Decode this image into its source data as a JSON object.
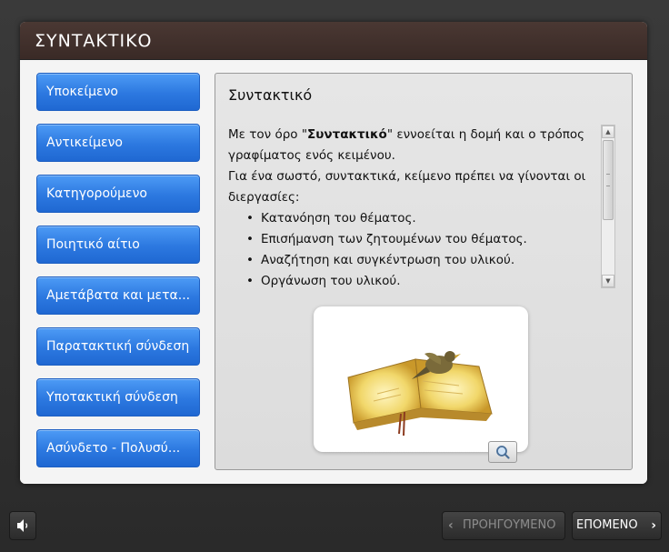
{
  "window": {
    "title": "ΣΥΝΤΑΚΤΙΚΟ"
  },
  "menu": {
    "items": [
      {
        "label": "Υποκείμενο"
      },
      {
        "label": "Αντικείμενο"
      },
      {
        "label": "Κατηγορούμενο"
      },
      {
        "label": "Ποιητικό αίτιο"
      },
      {
        "label": "Αμετάβατα και μετα..."
      },
      {
        "label": "Παρατακτική σύνδεση"
      },
      {
        "label": "Υποτακτική σύνδεση"
      },
      {
        "label": "Ασύνδετο - Πολυσύ..."
      }
    ]
  },
  "content": {
    "title": "Συντακτικό",
    "intro_prefix": "Με τον όρο \"",
    "intro_term": "Συντακτικό",
    "intro_suffix": "\" εννοείται η δομή και ο τρόπος γραφίματος ενός κειμένου.",
    "intro_line2": "Για ένα σωστό, συντακτικά, κείμενο πρέπει να γίνονται οι διεργασίες:",
    "bullets": [
      "Κατανόηση του θέματος.",
      "Επισήμανση των ζητουμένων του θέματος.",
      "Αναζήτηση και συγκέντρωση του υλικού.",
      "Οργάνωση του υλικού."
    ]
  },
  "footer": {
    "prev_label": "ΠΡΟΗΓΟΥΜΕΝΟ",
    "next_label": "ΕΠΟΜΕΝΟ",
    "prev_enabled": false
  },
  "icons": {
    "sound": "speaker-icon",
    "zoom": "magnifier-icon",
    "image": "open-book-with-bird-illustration"
  },
  "colors": {
    "title_bar": "#3f2f2b",
    "menu_button": "#2c78e0",
    "panel": "#f4f4f4"
  }
}
